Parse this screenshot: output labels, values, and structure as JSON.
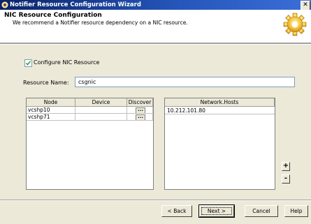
{
  "window": {
    "title": "Notifier Resource Configuration Wizard",
    "close_glyph": "✕"
  },
  "header": {
    "title": "NIC Resource Configuration",
    "subtitle": "We recommend a Notifier resource dependency on a NIC resource.",
    "icon": "gear-icon"
  },
  "form": {
    "configure_nic_label": "Configure NIC Resource",
    "configure_nic_checked": true,
    "resource_name_label": "Resource Name:",
    "resource_name_value": "csgnic"
  },
  "node_table": {
    "columns": [
      "Node",
      "Device",
      "Discover"
    ],
    "rows": [
      {
        "node": "vcshp10",
        "device": "",
        "discover": "..."
      },
      {
        "node": "vcshp71",
        "device": "",
        "discover": "..."
      }
    ]
  },
  "hosts_table": {
    "column": "Network.Hosts",
    "rows": [
      "10.212.101.80"
    ]
  },
  "side_buttons": {
    "add": "+",
    "remove": "-"
  },
  "footer": {
    "back": "< Back",
    "next": "Next >",
    "cancel": "Cancel",
    "help": "Help"
  },
  "colors": {
    "titlebar": "#0a246a",
    "dialog_bg": "#ece9d8"
  }
}
